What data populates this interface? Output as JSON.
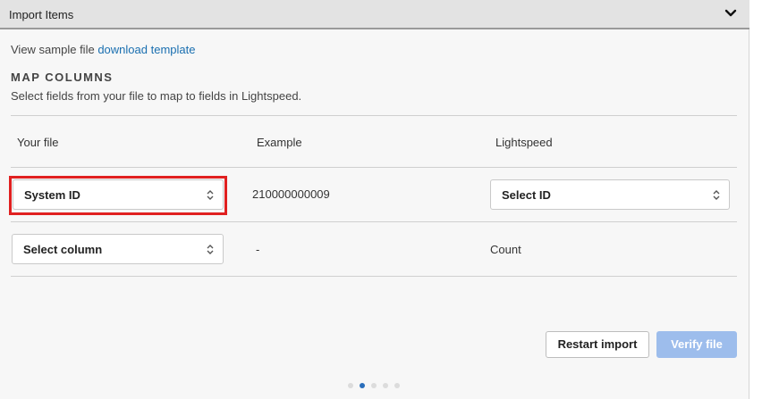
{
  "header": {
    "title": "Import Items",
    "toggle_icon": "chevron-down-icon"
  },
  "sample": {
    "prefix": "View sample file",
    "link": "download template"
  },
  "map_columns": {
    "title": "MAP COLUMNS",
    "description": "Select fields from your file to map to fields in Lightspeed."
  },
  "table": {
    "headers": [
      "Your file",
      "Example",
      "Lightspeed"
    ],
    "rows": [
      {
        "your_file": "System ID",
        "example": "210000000009",
        "lightspeed": "Select ID"
      },
      {
        "your_file": "Select column",
        "example": "-",
        "lightspeed": "Count"
      }
    ]
  },
  "buttons": {
    "restart": "Restart import",
    "verify": "Verify file"
  },
  "pagination": {
    "total_steps": 5,
    "current_step": 2
  },
  "colors": {
    "accent": "#1a6fb0",
    "highlight": "#e02020",
    "verify_disabled": "#9dbdec",
    "dot_active": "#2a6ebb"
  }
}
